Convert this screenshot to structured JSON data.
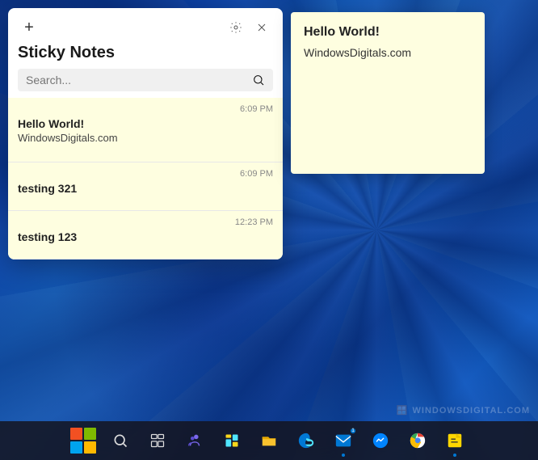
{
  "wallpaper": {
    "alt": "Windows 11 blue swirl wallpaper"
  },
  "sticky_notes_window": {
    "title": "Sticky Notes",
    "add_button_label": "+",
    "search": {
      "placeholder": "Search...",
      "value": ""
    },
    "notes": [
      {
        "id": 1,
        "timestamp": "6:09 PM",
        "title": "Hello World!",
        "body": "WindowsDigitals.com"
      },
      {
        "id": 2,
        "timestamp": "6:09 PM",
        "title": "testing 321",
        "body": ""
      },
      {
        "id": 3,
        "timestamp": "12:23 PM",
        "title": "testing 123",
        "body": ""
      }
    ]
  },
  "open_note": {
    "title": "Hello World!",
    "body": "WindowsDigitals.com"
  },
  "taskbar": {
    "icons": [
      {
        "name": "start",
        "label": "Start"
      },
      {
        "name": "search",
        "label": "Search"
      },
      {
        "name": "task-view",
        "label": "Task View"
      },
      {
        "name": "meet",
        "label": "Microsoft Teams"
      },
      {
        "name": "widgets",
        "label": "Widgets"
      },
      {
        "name": "file-explorer",
        "label": "File Explorer"
      },
      {
        "name": "edge",
        "label": "Microsoft Edge"
      },
      {
        "name": "mail",
        "label": "Mail"
      },
      {
        "name": "messenger",
        "label": "Messenger"
      },
      {
        "name": "chrome",
        "label": "Google Chrome"
      },
      {
        "name": "sticky-notes",
        "label": "Sticky Notes"
      }
    ]
  },
  "watermark": {
    "icon": "🪟",
    "text": "WINDOWSDIGITAL.COM"
  }
}
